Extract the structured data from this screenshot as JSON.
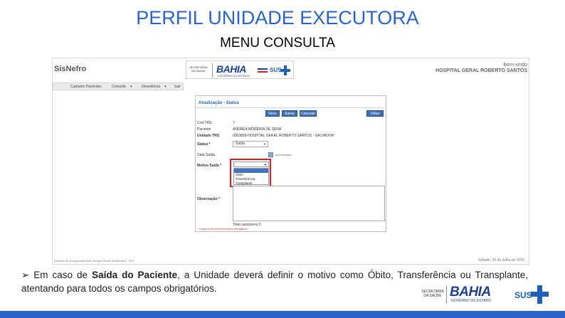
{
  "slide": {
    "title": "PERFIL UNIDADE EXECUTORA",
    "subtitle": "MENU CONSULTA",
    "caption_bullet": "➢",
    "caption_pre": " Em caso de ",
    "caption_bold": "Saída do Paciente",
    "caption_post": ", a Unidade deverá definir o motivo como Óbito, Transferência ou Transplante, atentando para todos os campos obrigatórios."
  },
  "app": {
    "logo": "SisNefro",
    "banner_sec": "SECRETARIA DA SAÚDE",
    "banner_bahia": "BAHIA",
    "banner_gov": "GOVERNO DO ESTADO",
    "banner_sus": "SUS",
    "welcome": "Bem-vindo",
    "hospital": "HOSPITAL GERAL ROBERTO SANTOS",
    "menu": [
      "Cadastro Pacientes",
      "Consulta",
      "Desistência",
      "Sair"
    ],
    "footer_left": "Sistema de Acompanhamento Terapia Renal Substitutiva - TRS",
    "footer_right": "Sábado, 25 de Julho de 2015"
  },
  "panel": {
    "title": "Atualização - Status",
    "buttons": [
      "Novo",
      "Salvar",
      "Cancelar",
      "Voltar"
    ],
    "labels": {
      "cod_trs": "Cod TRS",
      "paciente": "Paciente",
      "unidade": "Unidade TRS",
      "status": "Status *",
      "data_saida": "Data Saída",
      "motivo": "Motivo Saída *",
      "observacao": "Observação *"
    },
    "values": {
      "cod_trs": "7",
      "paciente": "ANDREA MOREIRA DE SENA",
      "unidade": "0003859-HOSPITAL GERAL ROBERTO SANTOS - SALVADOR"
    },
    "status_value": "Saída",
    "date_hint": "dd/mm/aaaa",
    "motivo_options": [
      "Óbito",
      "Transferência",
      "Transplante"
    ],
    "total_label": "Total caracteres",
    "total_value": "0",
    "required_note": "* Campos de preenchimento obrigatório"
  },
  "footer_logos": {
    "sec": "SECRETARIA DA SAÚDE",
    "bahia": "BAHIA",
    "gov": "GOVERNO DO ESTADO",
    "sus": "SUS"
  },
  "colors": {
    "title_blue": "#2a64c8",
    "button_blue": "#3d6eb0",
    "highlight_red": "#d42020",
    "selected_option": "#3f72c4"
  }
}
